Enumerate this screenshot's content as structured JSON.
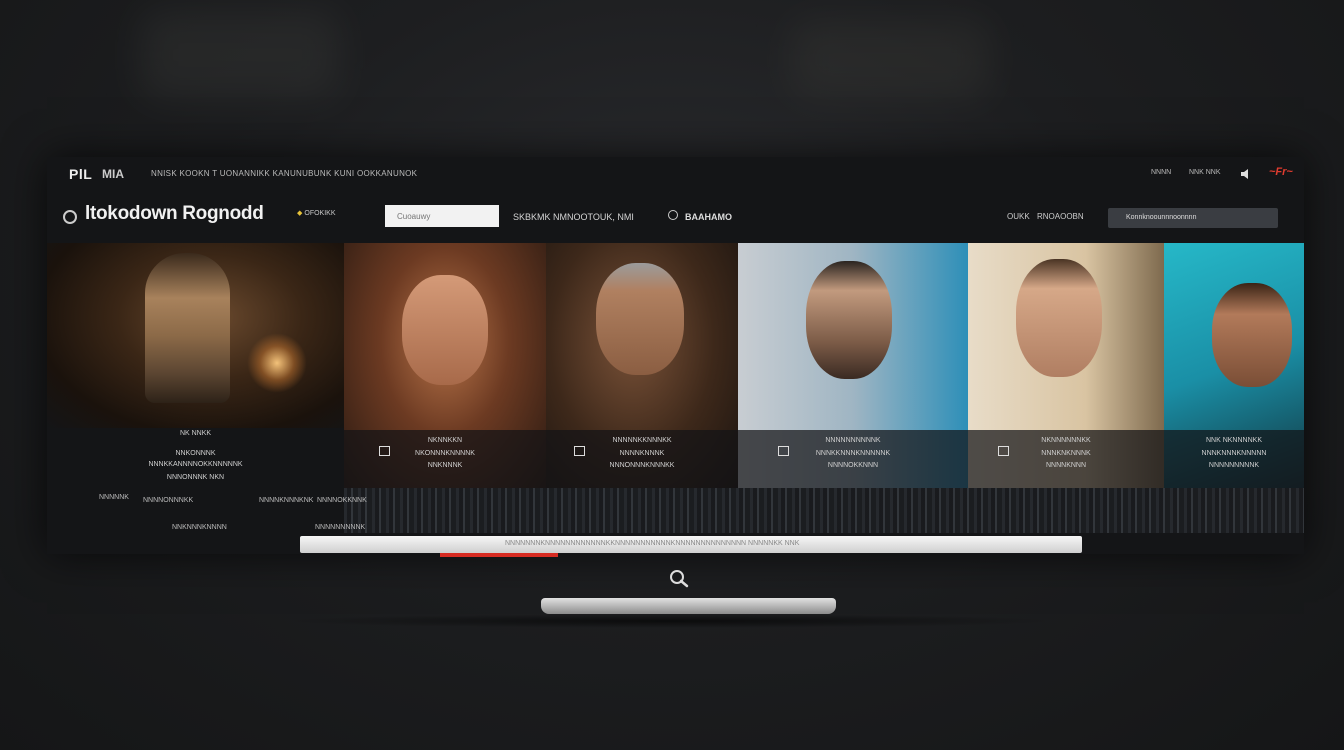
{
  "header": {
    "logo": "PlL",
    "logo_sub": "MIA",
    "menu_text": "NNISK KOOKN T UONANNIKK KANUNUBUNK KUNI OOKKANUNOK",
    "top_right_1": "NNNN",
    "top_right_2": "NNK NNK",
    "brand": "~Fr~"
  },
  "subheader": {
    "title": "ltokodown Rognodd",
    "badge": "OFOKIKK",
    "search_placeholder": "Cuoauwy",
    "nav_text": "SKBKMK NMNOOTOUK, NMI",
    "nav_text_2": "BAAHAMO",
    "right_label_1": "OUKK",
    "right_label_2": "RNOAOOBN",
    "dropdown": "Konnknoounnnoonnnn"
  },
  "feature": {
    "line1": "NK NNKK",
    "line2": "NNKONNNK",
    "line3": "NNNKKANNNNOKKNNNNNK",
    "line4": "NNNONNNK  NKN"
  },
  "cards": [
    {
      "line1": "NKNNKKN",
      "line2": "NKONNNKNNNNK",
      "line3": "NNKNNNK"
    },
    {
      "line1": "NNNNNKKNNNKK",
      "line2": "NNNNKNNNK",
      "line3": "NNNONNNKNNNKK"
    },
    {
      "line1": "NNNNNNNNNNK",
      "line2": "NNNKKNNNKNNNNNK",
      "line3": "NNNNOKKNNN"
    },
    {
      "line1": "NKNNNNNNKK",
      "line2": "NNNKNKNNNK",
      "line3": "NNNNKNNN"
    },
    {
      "line1": "NNK NKNNNNKK",
      "line2": "NNNKNNNKNNNNN",
      "line3": "NNNNNNNNNK"
    }
  ],
  "strip": {
    "label1": "NNNNNK",
    "label2": "NNNNONNNKK",
    "label3": "NNNNKNNNKNK",
    "label4": "NNNNOKKNNK",
    "label5": "NNKNNNKNNNN",
    "label6": "NNNNNNNNNK",
    "bar_text": "NNNNNNNKNNNNNNNNNNNNKKNNNNNNNNNNNKNNNNNNNNNNNNNN   NNNNNKK   NNK"
  },
  "progress": 0.15,
  "colors": {
    "accent": "#d62b22",
    "brand": "#e03c2f",
    "background": "#1b1c1e"
  },
  "icons": [
    "search-icon",
    "speaker-icon",
    "circle-icon",
    "chat-icon"
  ]
}
